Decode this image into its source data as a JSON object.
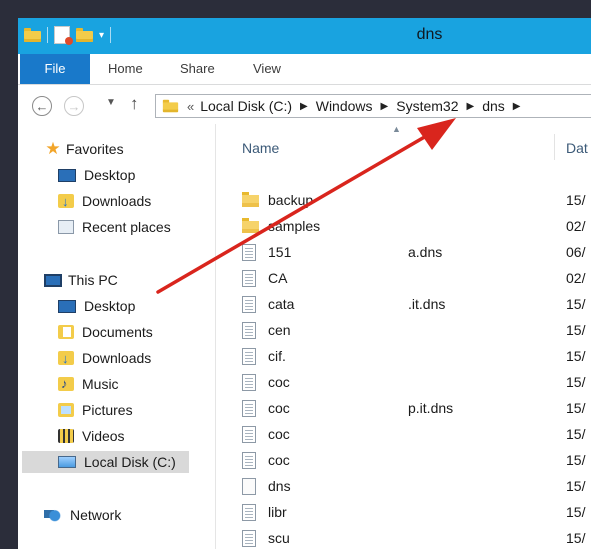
{
  "window": {
    "title": "dns"
  },
  "ribbon": {
    "file_label": "File",
    "home_label": "Home",
    "share_label": "Share",
    "view_label": "View"
  },
  "address": {
    "overflow": "«",
    "crumbs": [
      "Local Disk (C:)",
      "Windows",
      "System32",
      "dns"
    ]
  },
  "columns": {
    "name": "Name",
    "date": "Dat"
  },
  "nav_pane": {
    "favorites": {
      "label": "Favorites",
      "items": [
        "Desktop",
        "Downloads",
        "Recent places"
      ]
    },
    "this_pc": {
      "label": "This PC",
      "items": [
        "Desktop",
        "Documents",
        "Downloads",
        "Music",
        "Pictures",
        "Videos",
        "Local Disk (C:)"
      ]
    },
    "network": {
      "label": "Network"
    },
    "selected": "Local Disk (C:)"
  },
  "files": [
    {
      "name": "backup",
      "name_tail": "",
      "date": "15/",
      "type": "folder"
    },
    {
      "name": "samples",
      "name_tail": "",
      "date": "02/",
      "type": "folder"
    },
    {
      "name": "151",
      "name_tail": "a.dns",
      "date": "06/",
      "type": "file"
    },
    {
      "name": "CA",
      "name_tail": "",
      "date": "02/",
      "type": "file"
    },
    {
      "name": "cata",
      "name_tail": ".it.dns",
      "date": "15/",
      "type": "file"
    },
    {
      "name": "cen",
      "name_tail": "",
      "date": "15/",
      "type": "file"
    },
    {
      "name": "cif.",
      "name_tail": "",
      "date": "15/",
      "type": "file"
    },
    {
      "name": "coc",
      "name_tail": "",
      "date": "15/",
      "type": "file"
    },
    {
      "name": "coc",
      "name_tail": "p.it.dns",
      "date": "15/",
      "type": "file"
    },
    {
      "name": "coc",
      "name_tail": "",
      "date": "15/",
      "type": "file"
    },
    {
      "name": "coc",
      "name_tail": "",
      "date": "15/",
      "type": "file"
    },
    {
      "name": "dns",
      "name_tail": "",
      "date": "15/",
      "type": "plain"
    },
    {
      "name": "libr",
      "name_tail": "",
      "date": "15/",
      "type": "file"
    },
    {
      "name": "scu",
      "name_tail": "",
      "date": "15/",
      "type": "file"
    }
  ],
  "annotation": {
    "color": "#d9251d"
  },
  "colors": {
    "titlebar": "#19a3e0",
    "file_tab": "#1979ca",
    "selection": "#d9d9d9"
  }
}
